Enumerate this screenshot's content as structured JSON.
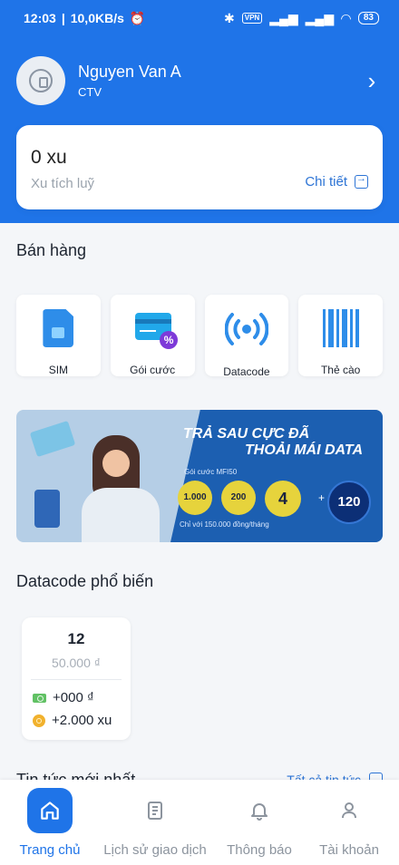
{
  "status_bar": {
    "time": "12:03",
    "network_speed": "10,0KB/s",
    "vpn_label": "VPN",
    "battery": "83"
  },
  "profile": {
    "name": "Nguyen Van A",
    "role": "CTV"
  },
  "points_card": {
    "value": "0 xu",
    "label": "Xu tích luỹ",
    "detail_link": "Chi tiết"
  },
  "sales_section": {
    "title": "Bán hàng",
    "tiles": [
      {
        "label": "SIM",
        "icon": "sim-card-icon"
      },
      {
        "label": "Gói cước",
        "icon": "card-percent-icon"
      },
      {
        "label": "Datacode",
        "icon": "wifi-signal-icon"
      },
      {
        "label": "Thẻ cào",
        "icon": "barcode-icon"
      }
    ]
  },
  "banner": {
    "headline_1": "TRẢ SAU CỰC ĐÃ",
    "headline_2": "THOẢI MÁI DATA",
    "package": "Gói cước MFI50",
    "badge_1": "1.000",
    "badge_2": "200",
    "badge_3": "4",
    "badge_4": "120",
    "plus": "+",
    "price_note": "Chỉ với 150.000 đồng/tháng"
  },
  "datacode_section": {
    "title": "Datacode phổ biến",
    "item": {
      "size": "12",
      "price": "50.000 ₫",
      "cashback": "+000 ₫",
      "points": "+2.000 xu"
    }
  },
  "news_section": {
    "title": "Tin tức mới nhất",
    "link": "Tất cả tin tức"
  },
  "bottom_nav": {
    "items": [
      {
        "label": "Trang chủ",
        "icon": "home-icon",
        "active": true
      },
      {
        "label": "Lịch sử giao dịch",
        "icon": "clipboard-icon",
        "active": false
      },
      {
        "label": "Thông báo",
        "icon": "bell-icon",
        "active": false
      },
      {
        "label": "Tài khoản",
        "icon": "user-icon",
        "active": false
      }
    ]
  },
  "colors": {
    "primary": "#1f74e8",
    "background": "#f4f6f9",
    "link": "#2d74d5"
  }
}
